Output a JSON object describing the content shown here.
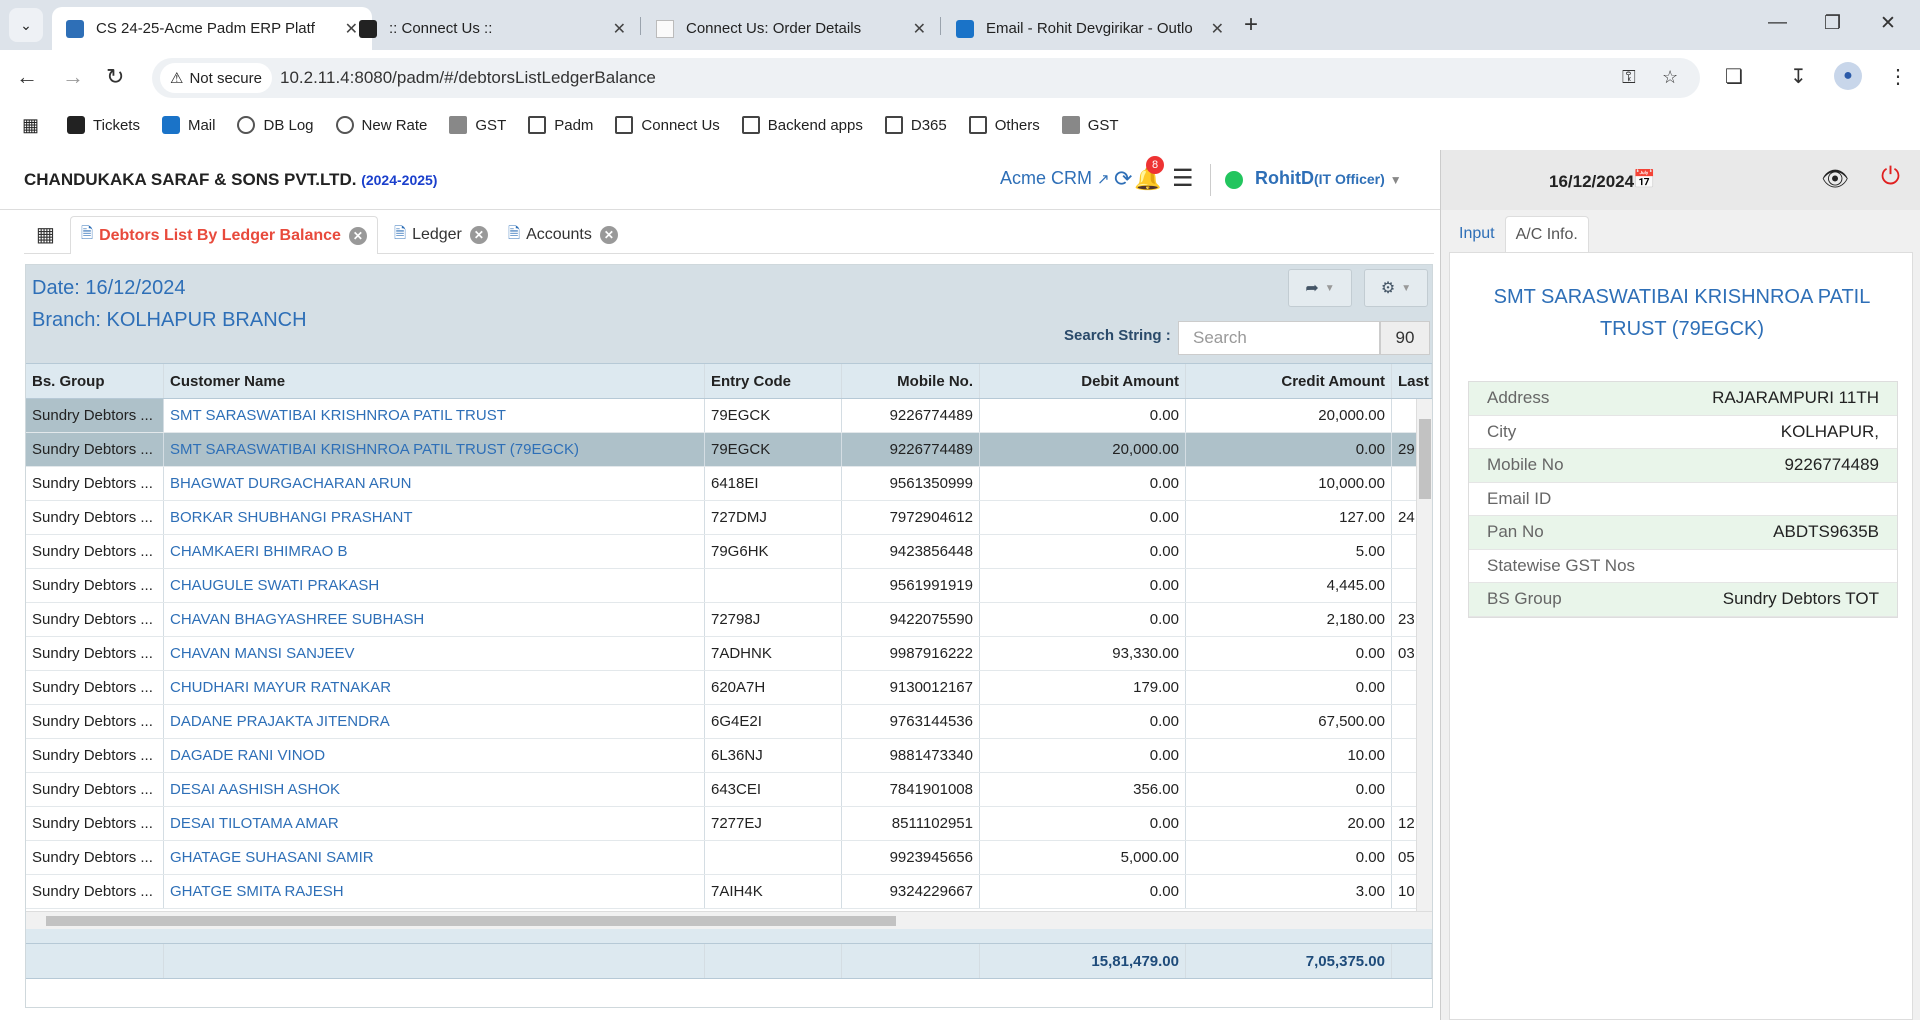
{
  "browser": {
    "tabs": [
      {
        "title": "CS 24-25-Acme Padm ERP Platf",
        "active": true
      },
      {
        "title": ":: Connect Us ::",
        "active": false
      },
      {
        "title": "Connect Us: Order Details",
        "active": false
      },
      {
        "title": "Email - Rohit Devgirikar - Outlo",
        "active": false
      }
    ],
    "security_label": "Not secure",
    "url": "10.2.11.4:8080/padm/#/debtorsListLedgerBalance",
    "bookmarks": [
      "Tickets",
      "Mail",
      "DB Log",
      "New Rate",
      "GST",
      "Padm",
      "Connect Us",
      "Backend apps",
      "D365",
      "Others",
      "GST"
    ]
  },
  "app": {
    "company": "CHANDUKAKA SARAF & SONS PVT.LTD.",
    "year": "(2024-2025)",
    "crm_label": "Acme CRM",
    "notification_count": "8",
    "user": "RohitD",
    "role": "(IT Officer)",
    "date": "16/12/2024",
    "tabs": [
      {
        "label": "Debtors List By Ledger Balance",
        "active": true
      },
      {
        "label": "Ledger",
        "active": false
      },
      {
        "label": "Accounts",
        "active": false
      }
    ]
  },
  "panel": {
    "date_line": "Date: 16/12/2024",
    "branch_line": "Branch: KOLHAPUR BRANCH",
    "search_label": "Search String :",
    "search_placeholder": "Search",
    "record_count": "90",
    "columns": [
      "Bs. Group",
      "Customer Name",
      "Entry Code",
      "Mobile No.",
      "Debit Amount",
      "Credit Amount",
      "Last"
    ],
    "rows": [
      {
        "group": "Sundry Debtors ...",
        "name": "SMT SARASWATIBAI KRISHNROA PATIL TRUST",
        "code": "79EGCK",
        "mobile": "9226774489",
        "debit": "0.00",
        "credit": "20,000.00",
        "last": ""
      },
      {
        "group": "Sundry Debtors ...",
        "name": "SMT SARASWATIBAI KRISHNROA PATIL TRUST (79EGCK)",
        "code": "79EGCK",
        "mobile": "9226774489",
        "debit": "20,000.00",
        "credit": "0.00",
        "last": "29"
      },
      {
        "group": "Sundry Debtors ...",
        "name": "BHAGWAT DURGACHARAN ARUN",
        "code": "6418EI",
        "mobile": "9561350999",
        "debit": "0.00",
        "credit": "10,000.00",
        "last": ""
      },
      {
        "group": "Sundry Debtors ...",
        "name": "BORKAR SHUBHANGI PRASHANT",
        "code": "727DMJ",
        "mobile": "7972904612",
        "debit": "0.00",
        "credit": "127.00",
        "last": "24"
      },
      {
        "group": "Sundry Debtors ...",
        "name": "CHAMKAERI BHIMRAO B",
        "code": "79G6HK",
        "mobile": "9423856448",
        "debit": "0.00",
        "credit": "5.00",
        "last": ""
      },
      {
        "group": "Sundry Debtors ...",
        "name": "CHAUGULE SWATI PRAKASH",
        "code": "",
        "mobile": "9561991919",
        "debit": "0.00",
        "credit": "4,445.00",
        "last": ""
      },
      {
        "group": "Sundry Debtors ...",
        "name": "CHAVAN BHAGYASHREE SUBHASH",
        "code": "72798J",
        "mobile": "9422075590",
        "debit": "0.00",
        "credit": "2,180.00",
        "last": "23"
      },
      {
        "group": "Sundry Debtors ...",
        "name": "CHAVAN MANSI SANJEEV",
        "code": "7ADHNK",
        "mobile": "9987916222",
        "debit": "93,330.00",
        "credit": "0.00",
        "last": "03"
      },
      {
        "group": "Sundry Debtors ...",
        "name": "CHUDHARI MAYUR RATNAKAR",
        "code": "620A7H",
        "mobile": "9130012167",
        "debit": "179.00",
        "credit": "0.00",
        "last": ""
      },
      {
        "group": "Sundry Debtors ...",
        "name": "DADANE PRAJAKTA JITENDRA",
        "code": "6G4E2I",
        "mobile": "9763144536",
        "debit": "0.00",
        "credit": "67,500.00",
        "last": ""
      },
      {
        "group": "Sundry Debtors ...",
        "name": "DAGADE RANI VINOD",
        "code": "6L36NJ",
        "mobile": "9881473340",
        "debit": "0.00",
        "credit": "10.00",
        "last": ""
      },
      {
        "group": "Sundry Debtors ...",
        "name": "DESAI AASHISH ASHOK",
        "code": "643CEI",
        "mobile": "7841901008",
        "debit": "356.00",
        "credit": "0.00",
        "last": ""
      },
      {
        "group": "Sundry Debtors ...",
        "name": "DESAI TILOTAMA AMAR",
        "code": "7277EJ",
        "mobile": "8511102951",
        "debit": "0.00",
        "credit": "20.00",
        "last": "12"
      },
      {
        "group": "Sundry Debtors ...",
        "name": "GHATAGE SUHASANI SAMIR",
        "code": "",
        "mobile": "9923945656",
        "debit": "5,000.00",
        "credit": "0.00",
        "last": "05"
      },
      {
        "group": "Sundry Debtors ...",
        "name": "GHATGE SMITA RAJESH",
        "code": "7AIH4K",
        "mobile": "9324229667",
        "debit": "0.00",
        "credit": "3.00",
        "last": "10"
      }
    ],
    "totals": {
      "debit": "15,81,479.00",
      "credit": "7,05,375.00"
    }
  },
  "sidepanel": {
    "tabs": [
      {
        "label": "Input",
        "active": false
      },
      {
        "label": "A/C Info.",
        "active": true
      }
    ],
    "account_name": "SMT SARASWATIBAI KRISHNROA PATIL TRUST (79EGCK)",
    "fields": [
      {
        "label": "Address",
        "value": "RAJARAMPURI 11TH"
      },
      {
        "label": "City",
        "value": "KOLHAPUR,"
      },
      {
        "label": "Mobile No",
        "value": "9226774489"
      },
      {
        "label": "Email ID",
        "value": ""
      },
      {
        "label": "Pan No",
        "value": "ABDTS9635B"
      },
      {
        "label": "Statewise GST Nos",
        "value": ""
      },
      {
        "label": "BS Group",
        "value": "Sundry Debtors TOT"
      }
    ]
  },
  "colors": {
    "link": "#2e6fb7",
    "active_tab": "#e84a3c",
    "selected_row": "#aec1c9",
    "status_online": "#22c55e",
    "power": "#e02020"
  }
}
